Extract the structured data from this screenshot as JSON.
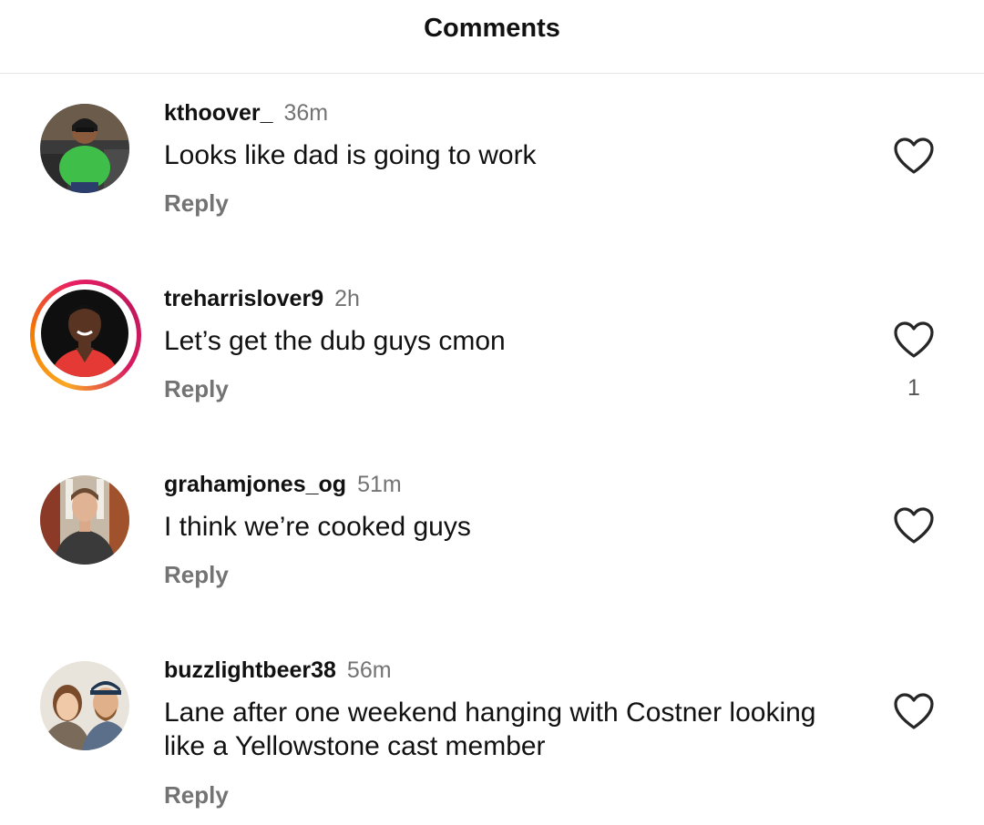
{
  "header": {
    "title": "Comments"
  },
  "comments": [
    {
      "username": "kthoover_",
      "time": "36m",
      "text": "Looks like dad is going to work",
      "reply_label": "Reply",
      "like_count": "",
      "has_story": false
    },
    {
      "username": "treharrislover9",
      "time": "2h",
      "text": "Let’s get the dub guys cmon",
      "reply_label": "Reply",
      "like_count": "1",
      "has_story": true
    },
    {
      "username": "grahamjones_og",
      "time": "51m",
      "text": "I think we’re cooked guys",
      "reply_label": "Reply",
      "like_count": "",
      "has_story": false
    },
    {
      "username": "buzzlightbeer38",
      "time": "56m",
      "text": "Lane after one weekend hanging with Costner looking like a Yellowstone cast member",
      "reply_label": "Reply",
      "like_count": "",
      "has_story": false
    }
  ],
  "icons": {
    "like": "heart-outline-icon"
  },
  "colors": {
    "secondary_text": "#737373",
    "story_ring_start": "#f9a825",
    "story_ring_end": "#d81b60"
  }
}
